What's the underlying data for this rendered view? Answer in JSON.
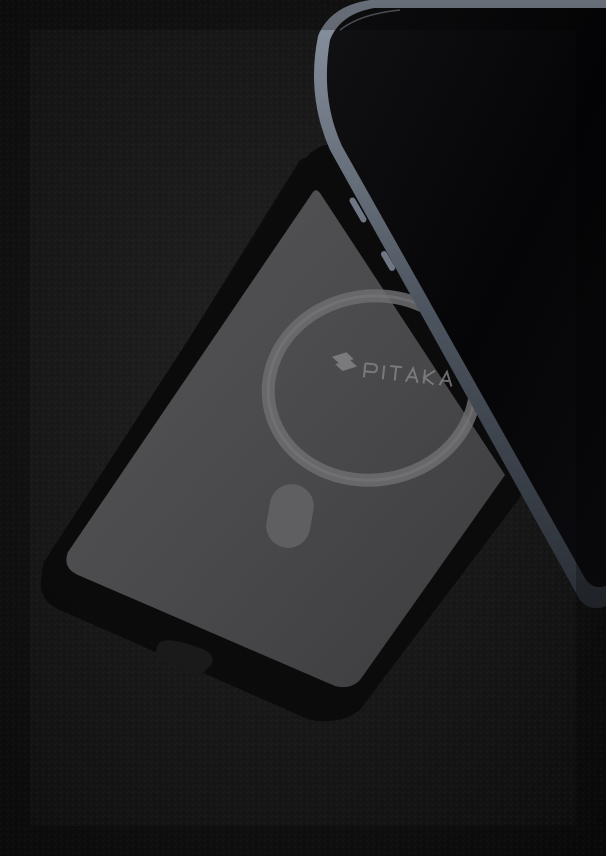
{
  "scene": {
    "subject": "phone-case-with-magnetic-ring-beside-phone",
    "brand_logo": {
      "wordmark": "PITAKA",
      "icon": "pitaka-logo-icon"
    },
    "colors": {
      "surface": "#161616",
      "case_frame": "#0b0b0b",
      "case_inner": "#4a4a4c",
      "magnet_ring": "#6d6d70",
      "phone_screen": "#050507",
      "phone_frame": "#5b6370"
    }
  }
}
